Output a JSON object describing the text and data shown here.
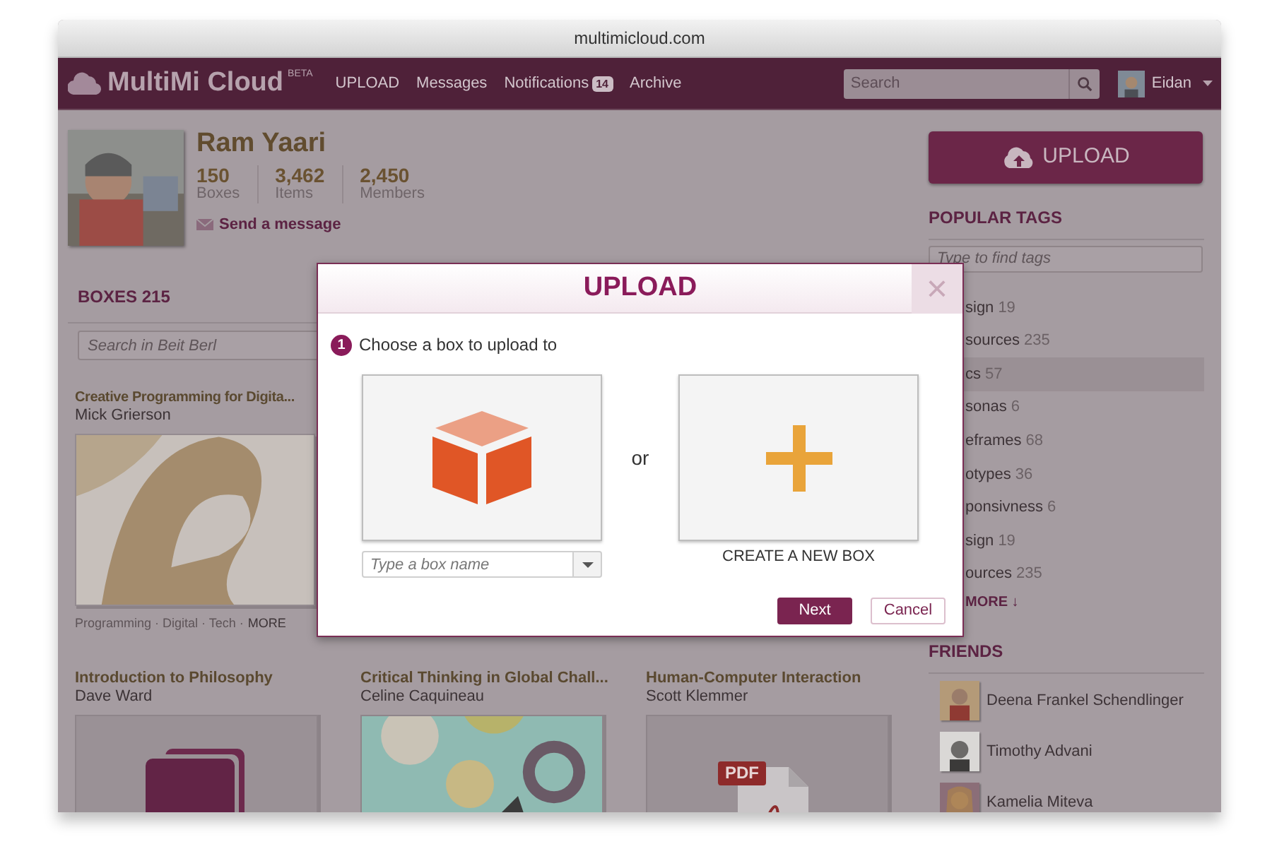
{
  "browser": {
    "address": "multimicloud.com"
  },
  "nav": {
    "logo": "MultiMi Cloud",
    "logo_badge": "BETA",
    "links": [
      {
        "label": "UPLOAD"
      },
      {
        "label": "Messages"
      },
      {
        "label": "Notifications",
        "badge": "14"
      },
      {
        "label": "Archive"
      }
    ],
    "search": {
      "placeholder": "Search"
    },
    "user": "Eidan"
  },
  "profile": {
    "name": "Ram Yaari",
    "stats": [
      {
        "value": "150",
        "label": "Boxes"
      },
      {
        "value": "3,462",
        "label": "Items"
      },
      {
        "value": "2,450",
        "label": "Members"
      }
    ],
    "message_link": "Send a message"
  },
  "boxes": {
    "heading": "BOXES 215",
    "search": {
      "placeholder": "Search in Beit Berl"
    },
    "featured": {
      "title": "Creative Programming for Digita...",
      "author": "Mick Grierson",
      "tags": "Programming · Digital · Tech ·",
      "more": "MORE"
    },
    "cards": [
      {
        "title": "Introduction to Philosophy",
        "author": "Dave Ward",
        "kind": "book"
      },
      {
        "title": "Critical Thinking in Global Chall...",
        "author": "Celine Caquineau",
        "kind": "picture"
      },
      {
        "title": "Human-Computer Interaction",
        "author": "Scott Klemmer",
        "kind": "pdf",
        "badge": "PDF"
      }
    ]
  },
  "sidebar": {
    "upload_button": "UPLOAD",
    "tags_heading": "POPULAR TAGS",
    "tags_search": {
      "placeholder": "Type to find tags"
    },
    "tags": [
      {
        "label": "sign",
        "count": "19",
        "selected": false
      },
      {
        "label": "sources",
        "count": "235",
        "selected": false
      },
      {
        "label": "cs",
        "count": "57",
        "selected": true
      },
      {
        "label": "sonas",
        "count": "6",
        "selected": false
      },
      {
        "label": "eframes",
        "count": "68",
        "selected": false
      },
      {
        "label": "otypes",
        "count": "36",
        "selected": false
      },
      {
        "label": "ponsivness",
        "count": "6",
        "selected": false
      },
      {
        "label": "sign",
        "count": "19",
        "selected": false
      },
      {
        "label": "ources",
        "count": "235",
        "selected": false
      }
    ],
    "tags_more": "MORE ↓",
    "friends_heading": "FRIENDS",
    "friends": [
      "Deena Frankel Schendlinger",
      "Timothy Advani",
      "Kamelia Miteva"
    ]
  },
  "dialog": {
    "title": "UPLOAD",
    "close": "×",
    "step_number": "1",
    "step_text": "Choose a box to upload to",
    "box_field": {
      "placeholder": "Type a box name"
    },
    "or": "or",
    "create_label": "CREATE A NEW BOX",
    "buttons": [
      {
        "label": "Next",
        "kind": "primary"
      },
      {
        "label": "Cancel",
        "kind": "secondary"
      }
    ]
  }
}
